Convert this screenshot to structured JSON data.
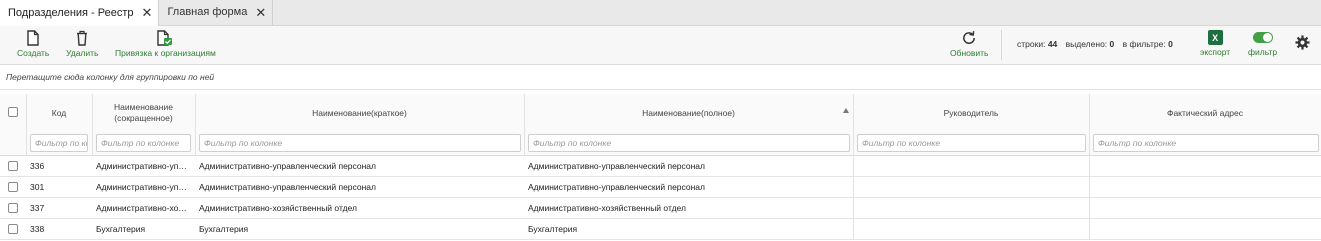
{
  "tabs": [
    {
      "label": "Подразделения - Реестр",
      "close": "✕"
    },
    {
      "label": "Главная форма",
      "close": "✕"
    }
  ],
  "toolbar": {
    "create_label": "Создать",
    "delete_label": "Удалить",
    "link_label": "Привязка к организациям",
    "refresh_label": "Обновить",
    "export_label": "экспорт",
    "filter_label": "фильтр",
    "excel_letter": "X"
  },
  "stats": {
    "rows_label": "строки:",
    "rows_value": "44",
    "selected_label": "выделено:",
    "selected_value": "0",
    "filtered_label": "в фильтре:",
    "filtered_value": "0"
  },
  "group_panel_text": "Перетащите сюда колонку для группировки по ней",
  "columns": [
    {
      "header": "Код",
      "filter": "Фильтр по колонке"
    },
    {
      "header": "Наименование (сокращенное)",
      "filter": "Фильтр по колонке"
    },
    {
      "header": "Наименование(краткое)",
      "filter": "Фильтр по колонке"
    },
    {
      "header": "Наименование(полное)",
      "filter": "Фильтр по колонке"
    },
    {
      "header": "Руководитель",
      "filter": "Фильтр по колонке"
    },
    {
      "header": "Фактический адрес",
      "filter": "Фильтр по колонке"
    }
  ],
  "rows": [
    {
      "code": "336",
      "short": "Административно-управленческий персонал",
      "brief": "Административно-управленческий персонал",
      "full": "Административно-управленческий персонал",
      "head": "",
      "address": ""
    },
    {
      "code": "301",
      "short": "Административно-управленческий персонал",
      "brief": "Административно-управленческий персонал",
      "full": "Административно-управленческий персонал",
      "head": "",
      "address": ""
    },
    {
      "code": "337",
      "short": "Административно-хозяйственный отдел",
      "brief": "Административно-хозяйственный отдел",
      "full": "Административно-хозяйственный отдел",
      "head": "",
      "address": ""
    },
    {
      "code": "338",
      "short": "Бухгалтерия",
      "brief": "Бухгалтерия",
      "full": "Бухгалтерия",
      "head": "",
      "address": ""
    }
  ],
  "colors": {
    "accent": "#2e7d32",
    "excel": "#1d6f42",
    "toggle": "#43a047"
  }
}
